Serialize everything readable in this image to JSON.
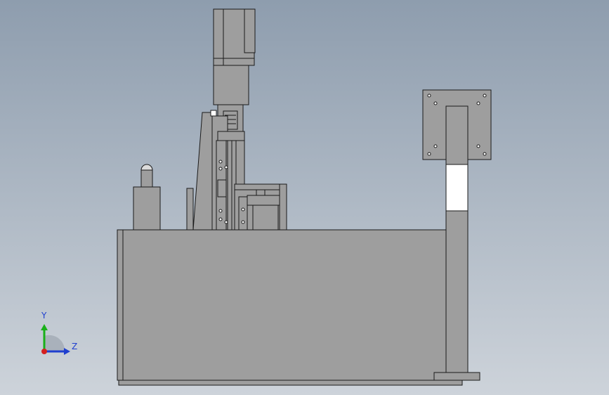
{
  "viewport": {
    "background_top": "#8e9dae",
    "background_bottom": "#cdd3da"
  },
  "model": {
    "face_color": "#9e9e9e",
    "edge_color": "#1a1a1a",
    "hole_color": "#ffffff"
  },
  "triad": {
    "y_label": "Y",
    "z_label": "Z",
    "x_color": "#d42020",
    "y_color": "#19b019",
    "z_color": "#1f3fcf",
    "label_color": "#1f3fcf"
  }
}
